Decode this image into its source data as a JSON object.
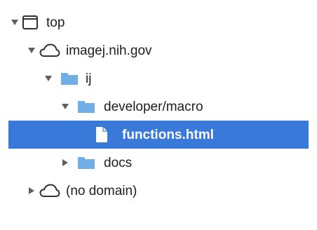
{
  "tree": {
    "top": {
      "label": "top",
      "expanded": true,
      "icon": "window-icon"
    },
    "domain": {
      "label": "imagej.nih.gov",
      "expanded": true,
      "icon": "cloud-icon"
    },
    "folder_ij": {
      "label": "ij",
      "expanded": true,
      "icon": "folder-icon"
    },
    "folder_macro": {
      "label": "developer/macro",
      "expanded": true,
      "icon": "folder-icon"
    },
    "file_functions": {
      "label": "functions.html",
      "selected": true,
      "icon": "file-icon"
    },
    "folder_docs": {
      "label": "docs",
      "expanded": false,
      "icon": "folder-icon"
    },
    "no_domain": {
      "label": "(no domain)",
      "expanded": false,
      "icon": "cloud-icon"
    }
  },
  "colors": {
    "selection": "#3879d9",
    "folder": "#72aee6",
    "arrow": "#5f5f5f",
    "text": "#202020"
  }
}
